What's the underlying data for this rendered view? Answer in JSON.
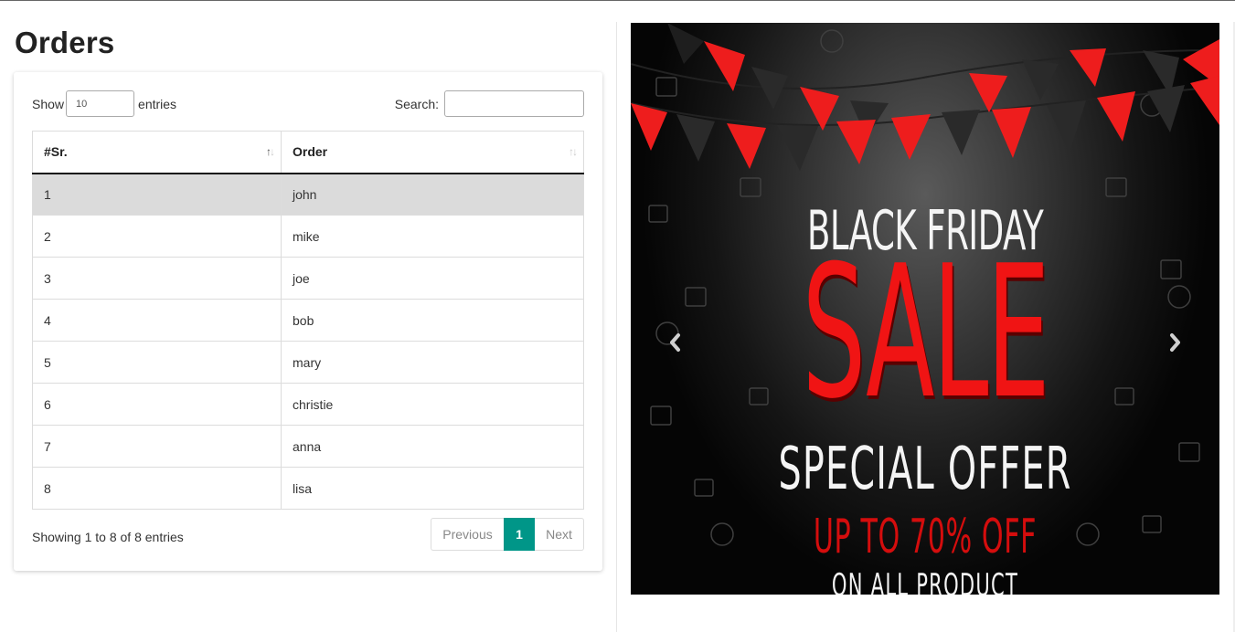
{
  "page": {
    "title": "Orders"
  },
  "table_controls": {
    "show_label": "Show",
    "page_length": "10",
    "entries_label": "entries",
    "search_label": "Search:",
    "search_value": ""
  },
  "table": {
    "columns": [
      {
        "label": "#Sr."
      },
      {
        "label": "Order"
      }
    ],
    "rows": [
      {
        "sr": "1",
        "order": "john"
      },
      {
        "sr": "2",
        "order": "mike"
      },
      {
        "sr": "3",
        "order": "joe"
      },
      {
        "sr": "4",
        "order": "bob"
      },
      {
        "sr": "5",
        "order": "mary"
      },
      {
        "sr": "6",
        "order": "christie"
      },
      {
        "sr": "7",
        "order": "anna"
      },
      {
        "sr": "8",
        "order": "lisa"
      }
    ],
    "sort_icon": "sort-arrows-icon"
  },
  "footer": {
    "info": "Showing 1 to 8 of 8 entries",
    "pagination": {
      "previous": "Previous",
      "current_page": "1",
      "next": "Next"
    }
  },
  "banner": {
    "line1": "BLACK FRIDAY",
    "line2": "SALE",
    "line3": "SPECIAL OFFER",
    "line4": "UP TO 70% OFF",
    "line5": "ON ALL PRODUCT",
    "prev_icon": "chevron-left-icon",
    "next_icon": "chevron-right-icon"
  },
  "colors": {
    "accent": "#009688",
    "selected_row": "#dbdbdb",
    "sale_red": "#f01414",
    "banner_bg": "#151515"
  }
}
